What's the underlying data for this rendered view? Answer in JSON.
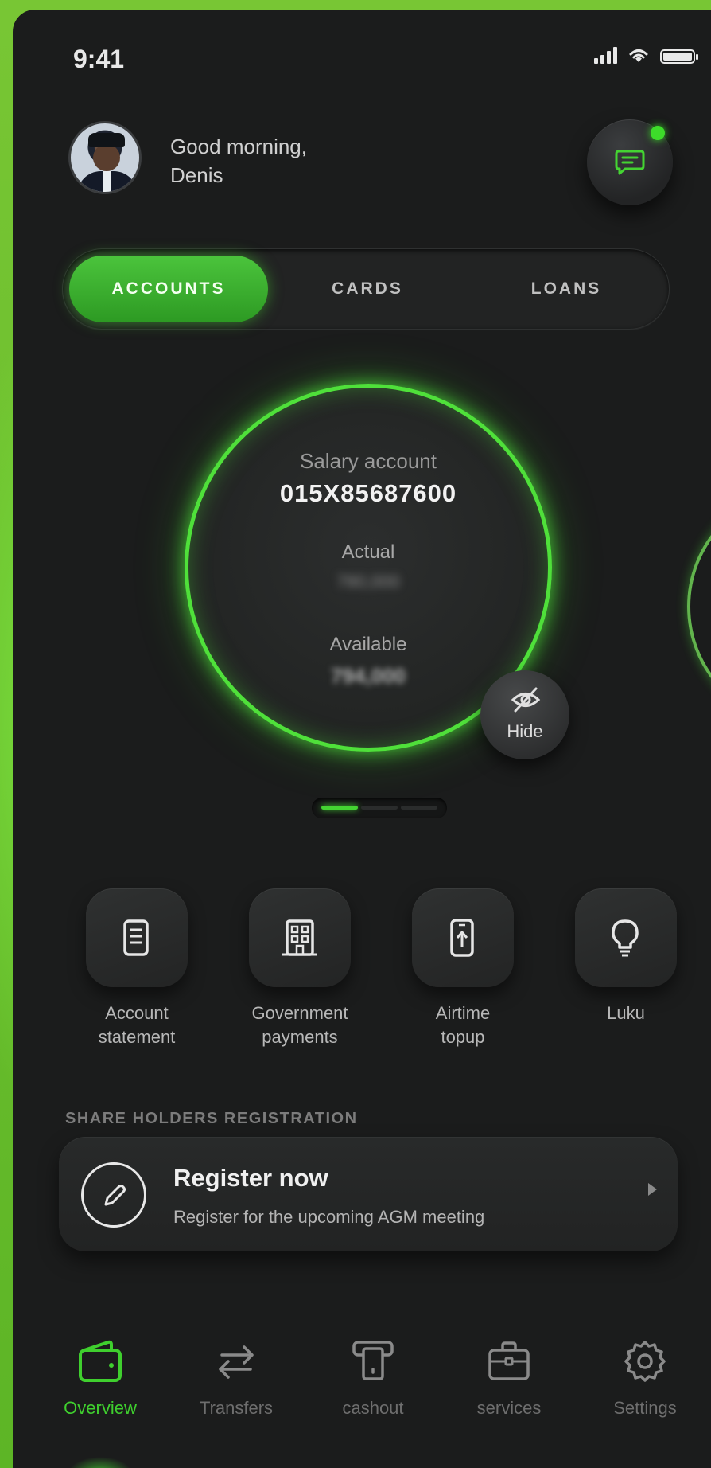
{
  "status_bar": {
    "time": "9:41"
  },
  "header": {
    "greeting_line1": "Good morning,",
    "greeting_line2": "Denis",
    "avatar_icon": "user-avatar",
    "message_icon": "chat-icon",
    "accent_color": "#3ddc2a"
  },
  "tabs": [
    {
      "label": "ACCOUNTS",
      "active": true
    },
    {
      "label": "CARDS",
      "active": false
    },
    {
      "label": "LOANS",
      "active": false
    }
  ],
  "account": {
    "title": "Salary account",
    "number": "015X85687600",
    "actual_label": "Actual",
    "actual_value": "780,000",
    "available_label": "Available",
    "available_value": "794,000",
    "hide_label": "Hide",
    "hide_icon": "eye-off-icon"
  },
  "pager": {
    "pages": 3,
    "current": 1
  },
  "quick_actions": [
    {
      "label_line1": "Account",
      "label_line2": "statement",
      "icon": "document-icon"
    },
    {
      "label_line1": "Government",
      "label_line2": "payments",
      "icon": "building-icon"
    },
    {
      "label_line1": "Airtime",
      "label_line2": "topup",
      "icon": "phone-topup-icon"
    },
    {
      "label_line1": "Luku",
      "label_line2": "",
      "icon": "lightbulb-icon"
    }
  ],
  "registration": {
    "section_label": "SHARE HOLDERS REGISTRATION",
    "title": "Register now",
    "subtitle": "Register for the upcoming AGM meeting",
    "icon": "pencil-icon"
  },
  "bottom_nav": [
    {
      "label": "Overview",
      "icon": "wallet-icon",
      "active": true
    },
    {
      "label": "Transfers",
      "icon": "transfer-arrows-icon",
      "active": false
    },
    {
      "label": "cashout",
      "icon": "atm-icon",
      "active": false
    },
    {
      "label": "services",
      "icon": "briefcase-icon",
      "active": false
    },
    {
      "label": "Settings",
      "icon": "gear-icon",
      "active": false
    }
  ],
  "colors": {
    "brand_green": "#44d432",
    "background": "#1b1c1c",
    "outer_green": "#6cc42a"
  }
}
